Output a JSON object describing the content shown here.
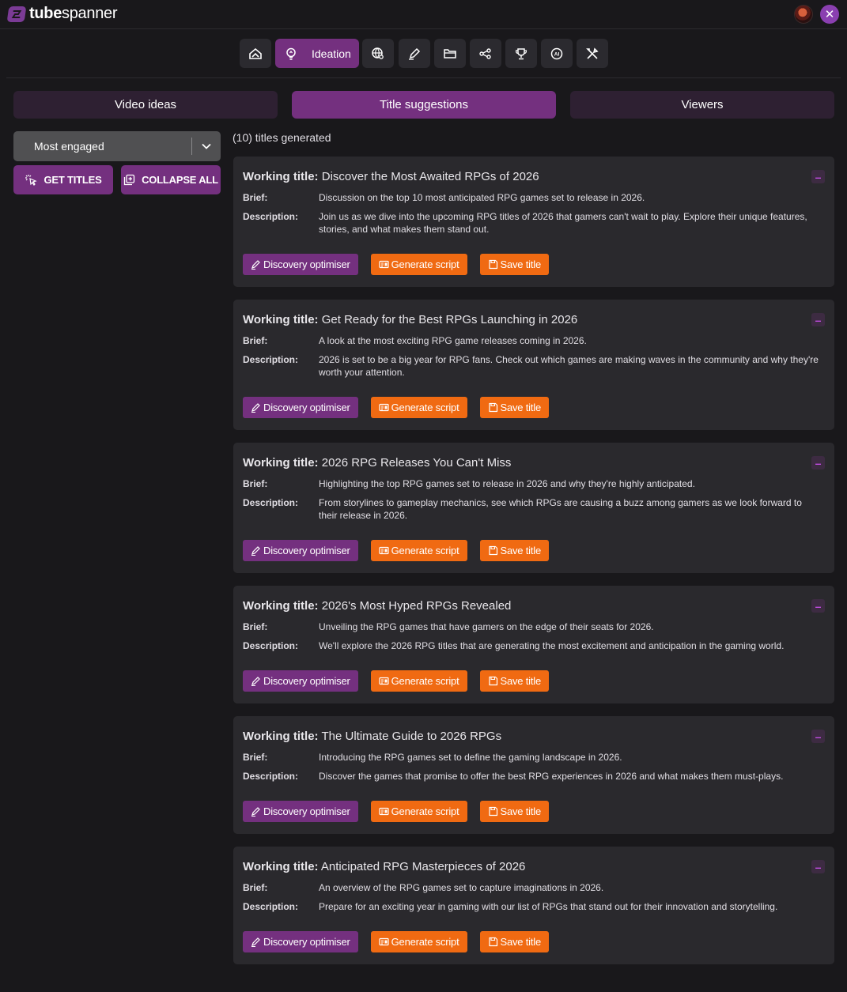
{
  "app": {
    "brand_bold": "tube",
    "brand_light": "spanner"
  },
  "toolbar": {
    "active_label": "Ideation"
  },
  "tabs": [
    {
      "label": "Video ideas",
      "active": false
    },
    {
      "label": "Title suggestions",
      "active": true
    },
    {
      "label": "Viewers",
      "active": false
    }
  ],
  "sort": {
    "selected": "Most engaged"
  },
  "actions": {
    "get_titles": "GET TITLES",
    "collapse_all": "COLLAPSE ALL"
  },
  "count_text": "(10) titles generated",
  "labels": {
    "working_title": "Working title:",
    "brief": "Brief:",
    "description": "Description:",
    "discovery": "Discovery optimiser",
    "generate": "Generate script",
    "save": "Save title",
    "collapse": "–"
  },
  "titles": [
    {
      "title": "Discover the Most Awaited RPGs of 2026",
      "brief": "Discussion on the top 10 most anticipated RPG games set to release in 2026.",
      "description": "Join us as we dive into the upcoming RPG titles of 2026 that gamers can't wait to play. Explore their unique features, stories, and what makes them stand out."
    },
    {
      "title": "Get Ready for the Best RPGs Launching in 2026",
      "brief": "A look at the most exciting RPG game releases coming in 2026.",
      "description": "2026 is set to be a big year for RPG fans. Check out which games are making waves in the community and why they're worth your attention."
    },
    {
      "title": "2026 RPG Releases You Can't Miss",
      "brief": "Highlighting the top RPG games set to release in 2026 and why they're highly anticipated.",
      "description": "From storylines to gameplay mechanics, see which RPGs are causing a buzz among gamers as we look forward to their release in 2026."
    },
    {
      "title": "2026's Most Hyped RPGs Revealed",
      "brief": "Unveiling the RPG games that have gamers on the edge of their seats for 2026.",
      "description": "We'll explore the 2026 RPG titles that are generating the most excitement and anticipation in the gaming world."
    },
    {
      "title": "The Ultimate Guide to 2026 RPGs",
      "brief": "Introducing the RPG games set to define the gaming landscape in 2026.",
      "description": "Discover the games that promise to offer the best RPG experiences in 2026 and what makes them must-plays."
    },
    {
      "title": "Anticipated RPG Masterpieces of 2026",
      "brief": "An overview of the RPG games set to capture imaginations in 2026.",
      "description": "Prepare for an exciting year in gaming with our list of RPGs that stand out for their innovation and storytelling."
    }
  ],
  "colors": {
    "accent": "#74307f",
    "orange": "#f06a12",
    "background": "#19181b",
    "card": "#2a292d"
  }
}
